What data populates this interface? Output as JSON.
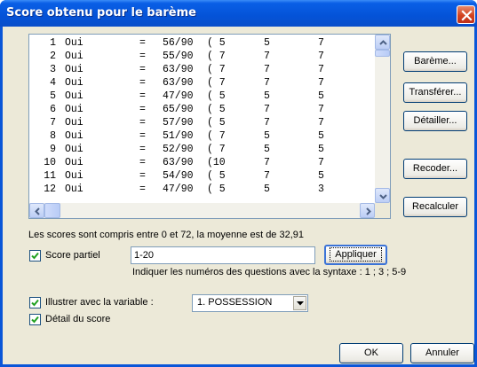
{
  "window": {
    "title": "Score obtenu pour le barème"
  },
  "list": {
    "rows": [
      {
        "num": "1",
        "answer": "Oui",
        "eq": "=",
        "score": "56/90",
        "c1": "( 5",
        "c2": "5",
        "c3": "7"
      },
      {
        "num": "2",
        "answer": "Oui",
        "eq": "=",
        "score": "55/90",
        "c1": "( 7",
        "c2": "7",
        "c3": "7"
      },
      {
        "num": "3",
        "answer": "Oui",
        "eq": "=",
        "score": "63/90",
        "c1": "( 7",
        "c2": "7",
        "c3": "7"
      },
      {
        "num": "4",
        "answer": "Oui",
        "eq": "=",
        "score": "63/90",
        "c1": "( 7",
        "c2": "7",
        "c3": "7"
      },
      {
        "num": "5",
        "answer": "Oui",
        "eq": "=",
        "score": "47/90",
        "c1": "( 5",
        "c2": "5",
        "c3": "5"
      },
      {
        "num": "6",
        "answer": "Oui",
        "eq": "=",
        "score": "65/90",
        "c1": "( 5",
        "c2": "7",
        "c3": "7"
      },
      {
        "num": "7",
        "answer": "Oui",
        "eq": "=",
        "score": "57/90",
        "c1": "( 5",
        "c2": "7",
        "c3": "7"
      },
      {
        "num": "8",
        "answer": "Oui",
        "eq": "=",
        "score": "51/90",
        "c1": "( 7",
        "c2": "5",
        "c3": "5"
      },
      {
        "num": "9",
        "answer": "Oui",
        "eq": "=",
        "score": "52/90",
        "c1": "( 7",
        "c2": "5",
        "c3": "5"
      },
      {
        "num": "10",
        "answer": "Oui",
        "eq": "=",
        "score": "63/90",
        "c1": "(10",
        "c2": "7",
        "c3": "7"
      },
      {
        "num": "11",
        "answer": "Oui",
        "eq": "=",
        "score": "54/90",
        "c1": "( 5",
        "c2": "7",
        "c3": "5"
      },
      {
        "num": "12",
        "answer": "Oui",
        "eq": "=",
        "score": "47/90",
        "c1": "( 5",
        "c2": "5",
        "c3": "3"
      }
    ]
  },
  "buttons": {
    "bareme": "Barème...",
    "transferer": "Transférer...",
    "detailler": "Détailler...",
    "recoder": "Recoder...",
    "recalculer": "Recalculer",
    "appliquer": "Appliquer",
    "ok": "OK",
    "annuler": "Annuler"
  },
  "summary_text": "Les scores sont compris entre 0 et 72, la moyenne est de 32,91",
  "score_partiel": {
    "label": "Score partiel",
    "checked": true,
    "value": "1-20",
    "hint": "Indiquer les numéros des questions avec la syntaxe : 1 ; 3 ; 5-9"
  },
  "illustrer": {
    "label": "Illustrer avec la variable :",
    "checked": true,
    "selected": "1. POSSESSION"
  },
  "detail_score": {
    "label": "Détail du score",
    "checked": true
  },
  "icons": {
    "close": "close-icon",
    "check": "check-icon",
    "arrows": [
      "arrow-up-icon",
      "arrow-down-icon",
      "arrow-left-icon",
      "arrow-right-icon",
      "chevron-down-icon"
    ]
  },
  "colors": {
    "titlebar": "#0453d8",
    "dialog_bg": "#ece9d8",
    "close_button": "#d2421f",
    "scrollbar": "#bccef5",
    "check": "#21a121"
  }
}
